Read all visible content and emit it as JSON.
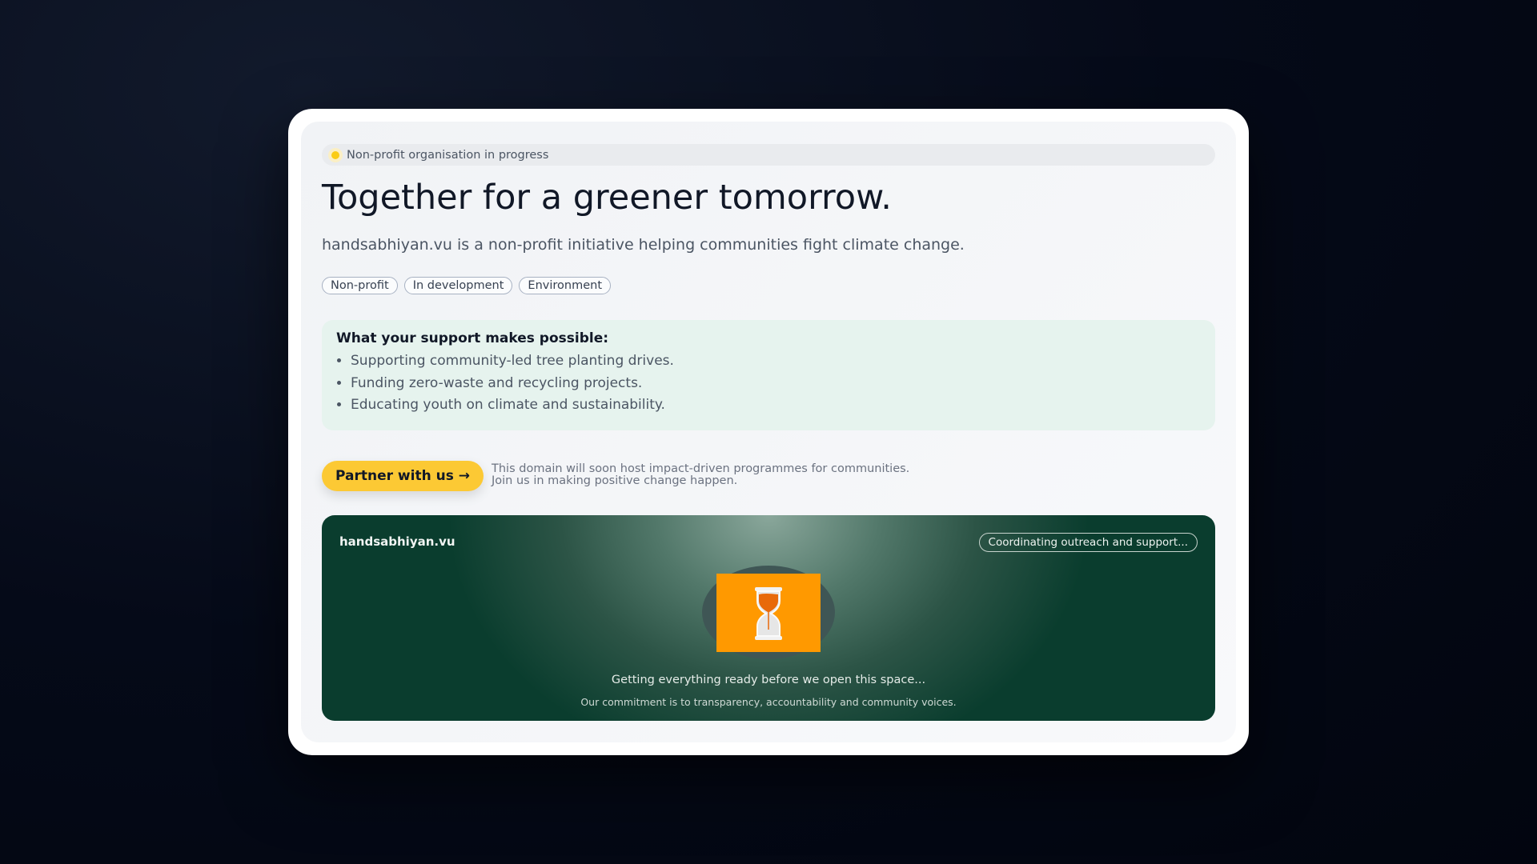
{
  "status": "Non-profit organisation in progress",
  "title": "Together for a greener tomorrow.",
  "subtitle": "handsabhiyan.vu is a non-profit initiative helping communities fight climate change.",
  "tags": [
    "Non-profit",
    "In development",
    "Environment"
  ],
  "support": {
    "heading": "What your support makes possible:",
    "items": [
      "Supporting community-led tree planting drives.",
      "Funding zero-waste and recycling projects.",
      "Educating youth on climate and sustainability."
    ]
  },
  "cta": {
    "label": "Partner with us →",
    "note_line1": "This domain will soon host impact-driven programmes for communities.",
    "note_line2": "Join us in making positive change happen."
  },
  "panel": {
    "domain": "handsabhiyan.vu",
    "badge": "Coordinating outreach and support...",
    "message": "Getting everything ready before we open this space...",
    "commitment": "Our commitment is to transparency, accountability and community voices.",
    "icon": "hourglass-icon"
  },
  "colors": {
    "accent": "#fcc934",
    "panel": "#0a3d2e",
    "icon_bg": "#ff9900"
  }
}
